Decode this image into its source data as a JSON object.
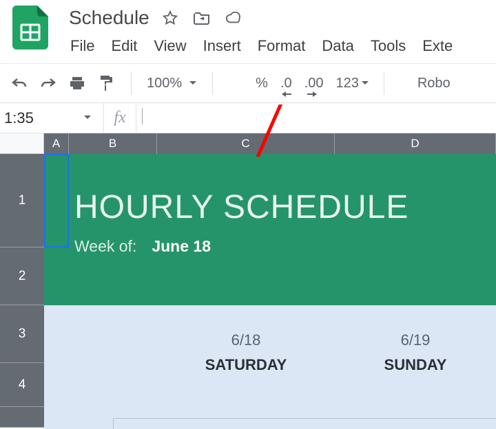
{
  "doc": {
    "title": "Schedule"
  },
  "menu": {
    "file": "File",
    "edit": "Edit",
    "view": "View",
    "insert": "Insert",
    "format": "Format",
    "data": "Data",
    "tools": "Tools",
    "extensions": "Exte"
  },
  "toolbar": {
    "zoom": "100%",
    "percent": "%",
    "dec_less": ".0",
    "dec_more": ".00",
    "n123": "123",
    "font": "Robo"
  },
  "formula": {
    "cellref": "1:35",
    "fx": "fx"
  },
  "cols": {
    "A": "A",
    "B": "B",
    "C": "C",
    "D": "D"
  },
  "rows": {
    "r1": "1",
    "r2": "2",
    "r3": "3",
    "r4": "4"
  },
  "banner": {
    "title": "HOURLY SCHEDULE",
    "week_label": "Week of:",
    "week_date": "June 18"
  },
  "days": {
    "c": {
      "date": "6/18",
      "name": "SATURDAY"
    },
    "d": {
      "date": "6/19",
      "name": "SUNDAY"
    }
  }
}
